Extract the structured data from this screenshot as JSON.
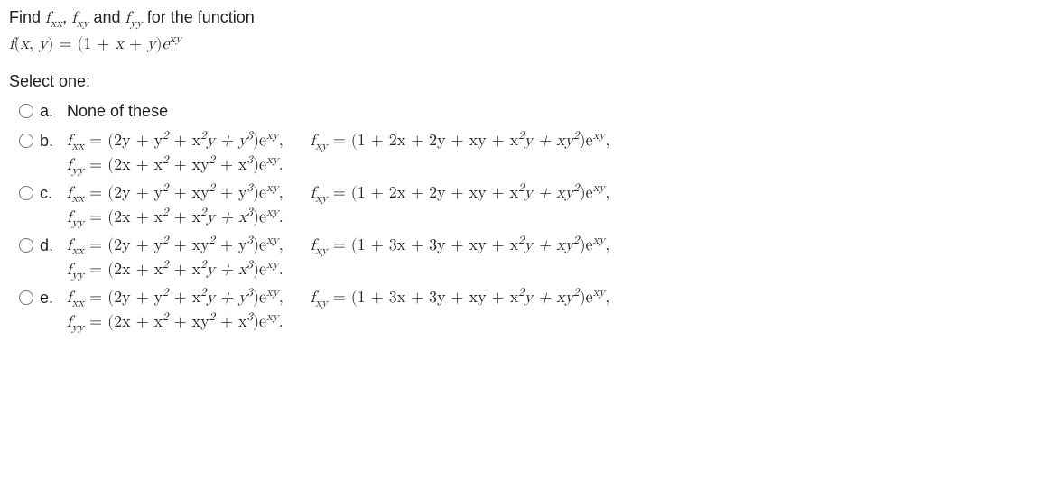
{
  "prompt": {
    "pre": "Find ",
    "f1": "f",
    "s1": "xx",
    "sep1": ", ",
    "f2": "f",
    "s2": "xy",
    "mid": " and ",
    "f3": "f",
    "s3": "yy",
    "post": " for the function"
  },
  "function_def": {
    "lhs_f": "f",
    "lhs_args_open": "(",
    "lhs_x": "x",
    "lhs_comma": ", ",
    "lhs_y": "y",
    "lhs_args_close": ") ",
    "eq": "= ",
    "rhs_open": "(1 + ",
    "rhs_x": "x",
    "rhs_plus": " + ",
    "rhs_y": "y",
    "rhs_close": ")",
    "rhs_e": "e",
    "rhs_exp": "xy"
  },
  "select_label": "Select one:",
  "options": {
    "a": {
      "letter": "a.",
      "text": "None of these"
    },
    "b": {
      "letter": "b.",
      "fxx": "f",
      "fxx_sub": "xx",
      "fxx_eq": " = (2y + y",
      "fxx_p2": "2",
      "fxx_mid1": " + x",
      "fxx_p2b": "2",
      "fxx_mid2": "y + y",
      "fxx_p3": "3",
      "fxx_end": ")e",
      "fxx_exp": "xy",
      "fxx_comma": ",",
      "fxy": "f",
      "fxy_sub": "xy",
      "fxy_eq": " = (1 + 2x + 2y + xy + x",
      "fxy_p2": "2",
      "fxy_mid": "y + xy",
      "fxy_p2b": "2",
      "fxy_end": ")e",
      "fxy_exp": "xy",
      "fxy_comma": ",",
      "fyy": "f",
      "fyy_sub": "yy",
      "fyy_eq": " = (2x + x",
      "fyy_p2": "2",
      "fyy_mid": " + xy",
      "fyy_p2b": "2",
      "fyy_mid2": " + x",
      "fyy_p3": "3",
      "fyy_end": ")e",
      "fyy_exp": "xy",
      "fyy_dot": "."
    },
    "c": {
      "letter": "c.",
      "fxx": "f",
      "fxx_sub": "xx",
      "fxx_eq": " = (2y + y",
      "fxx_p2": "2",
      "fxx_mid1": " + xy",
      "fxx_p2b": "2",
      "fxx_mid2": " + y",
      "fxx_p3": "3",
      "fxx_end": ")e",
      "fxx_exp": "xy",
      "fxx_comma": ",",
      "fxy": "f",
      "fxy_sub": "xy",
      "fxy_eq": " = (1 + 2x + 2y + xy + x",
      "fxy_p2": "2",
      "fxy_mid": "y + xy",
      "fxy_p2b": "2",
      "fxy_end": ")e",
      "fxy_exp": "xy",
      "fxy_comma": ",",
      "fyy": "f",
      "fyy_sub": "yy",
      "fyy_eq": " = (2x + x",
      "fyy_p2": "2",
      "fyy_mid": " + x",
      "fyy_p2b": "2",
      "fyy_mid2": "y + x",
      "fyy_p3": "3",
      "fyy_end": ")e",
      "fyy_exp": "xy",
      "fyy_dot": "."
    },
    "d": {
      "letter": "d.",
      "fxx": "f",
      "fxx_sub": "xx",
      "fxx_eq": " = (2y + y",
      "fxx_p2": "2",
      "fxx_mid1": " + xy",
      "fxx_p2b": "2",
      "fxx_mid2": " + y",
      "fxx_p3": "3",
      "fxx_end": ")e",
      "fxx_exp": "xy",
      "fxx_comma": ",",
      "fxy": "f",
      "fxy_sub": "xy",
      "fxy_eq": " = (1 + 3x + 3y + xy + x",
      "fxy_p2": "2",
      "fxy_mid": "y + xy",
      "fxy_p2b": "2",
      "fxy_end": ")e",
      "fxy_exp": "xy",
      "fxy_comma": ",",
      "fyy": "f",
      "fyy_sub": "yy",
      "fyy_eq": " = (2x + x",
      "fyy_p2": "2",
      "fyy_mid": " + x",
      "fyy_p2b": "2",
      "fyy_mid2": "y + x",
      "fyy_p3": "3",
      "fyy_end": ")e",
      "fyy_exp": "xy",
      "fyy_dot": "."
    },
    "e": {
      "letter": "e.",
      "fxx": "f",
      "fxx_sub": "xx",
      "fxx_eq": " = (2y + y",
      "fxx_p2": "2",
      "fxx_mid1": " + x",
      "fxx_p2b": "2",
      "fxx_mid2": "y + y",
      "fxx_p3": "3",
      "fxx_end": ")e",
      "fxx_exp": "xy",
      "fxx_comma": ",",
      "fxy": "f",
      "fxy_sub": "xy",
      "fxy_eq": " = (1 + 3x + 3y + xy + x",
      "fxy_p2": "2",
      "fxy_mid": "y + xy",
      "fxy_p2b": "2",
      "fxy_end": ")e",
      "fxy_exp": "xy",
      "fxy_comma": ",",
      "fyy": "f",
      "fyy_sub": "yy",
      "fyy_eq": " = (2x + x",
      "fyy_p2": "2",
      "fyy_mid": " + xy",
      "fyy_p2b": "2",
      "fyy_mid2": " + x",
      "fyy_p3": "3",
      "fyy_end": ")e",
      "fyy_exp": "xy",
      "fyy_dot": "."
    }
  }
}
